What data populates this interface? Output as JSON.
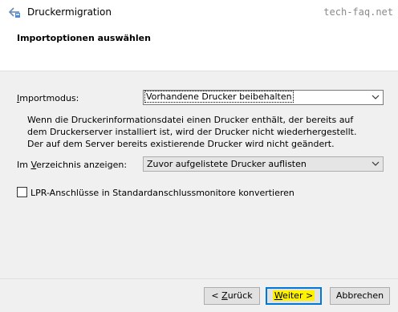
{
  "window": {
    "title": "Druckermigration",
    "watermark": "tech-faq.net"
  },
  "header": {
    "title": "Importoptionen auswählen"
  },
  "import_mode": {
    "label_prefix": "I",
    "label_rest": "mportmodus:",
    "selected": "Vorhandene Drucker beibehalten",
    "description": "Wenn die Druckerinformationsdatei einen Drucker enthält, der bereits auf dem Druckerserver installiert ist, wird der Drucker nicht wiederhergestellt. Der auf dem Server bereits existierende Drucker wird nicht geändert."
  },
  "directory": {
    "label_pre": "Im ",
    "label_ul": "V",
    "label_post": "erzeichnis anzeigen:",
    "selected": "Zuvor aufgelistete Drucker auflisten"
  },
  "lpr_checkbox": {
    "checked": false,
    "label": "LPR-Anschlüsse in Standardanschlussmonitore konvertieren"
  },
  "buttons": {
    "back_pre": "< ",
    "back_ul": "Z",
    "back_post": "urück",
    "next_ul": "W",
    "next_post": "eiter >",
    "cancel": "Abbrechen"
  }
}
